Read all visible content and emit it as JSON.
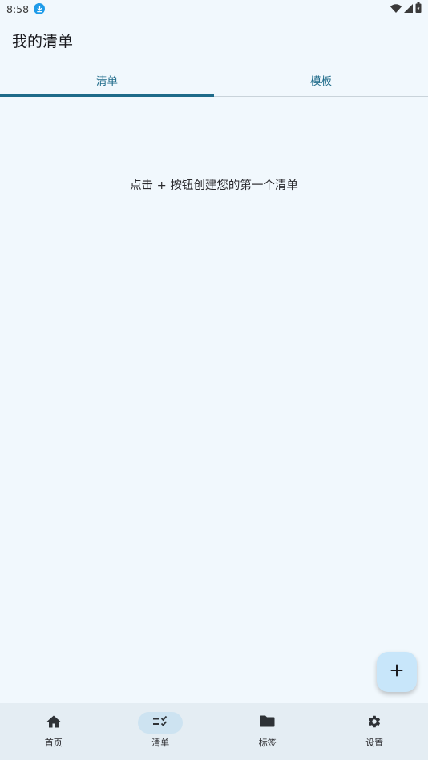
{
  "status_bar": {
    "time": "8:58"
  },
  "app_bar": {
    "title": "我的清单"
  },
  "tabs": [
    {
      "label": "清单",
      "active": true
    },
    {
      "label": "模板",
      "active": false
    }
  ],
  "empty_state": {
    "message": "点击 + 按钮创建您的第一个清单"
  },
  "fab": {
    "icon": "plus-icon"
  },
  "bottom_nav": [
    {
      "label": "首页",
      "icon": "home-icon",
      "active": false
    },
    {
      "label": "清单",
      "icon": "checklist-icon",
      "active": true
    },
    {
      "label": "标签",
      "icon": "folder-icon",
      "active": false
    },
    {
      "label": "设置",
      "icon": "gear-icon",
      "active": false
    }
  ],
  "colors": {
    "background": "#f1f8fd",
    "accent": "#1f6b8a",
    "fab": "#c8e6fa",
    "nav_background": "#e4edf3",
    "nav_active_pill": "#cde3f1"
  }
}
